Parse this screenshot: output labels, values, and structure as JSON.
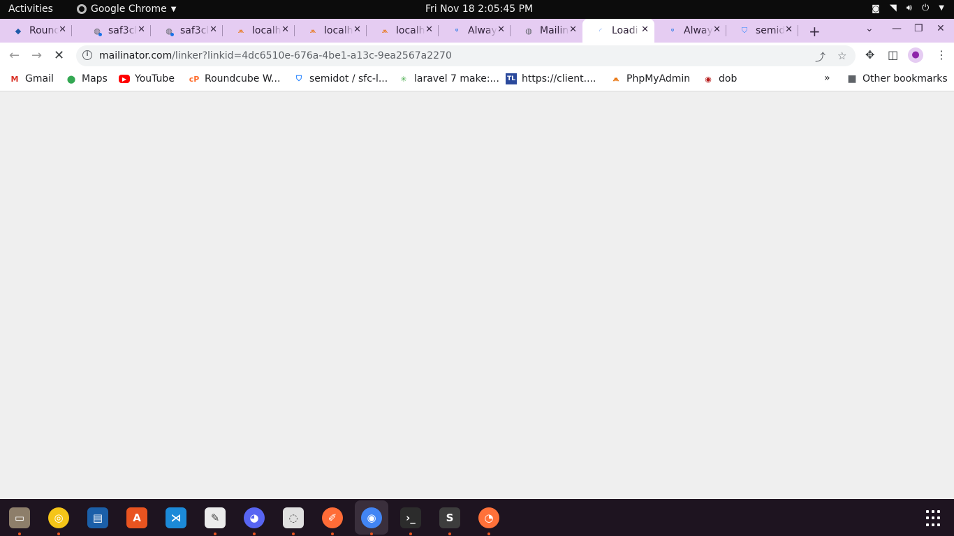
{
  "topbar": {
    "activities": "Activities",
    "app_name": "Google Chrome",
    "clock": "Fri Nov 18  2:05:45 PM"
  },
  "tabs": [
    {
      "title": "Roundcube",
      "icon": "roundcube-icon",
      "color": "#1e5aa8"
    },
    {
      "title": "saf3cl",
      "icon": "globe-icon",
      "color": "#5f6368"
    },
    {
      "title": "saf3cl",
      "icon": "globe-icon",
      "color": "#5f6368"
    },
    {
      "title": "localh",
      "icon": "phpmyadmin-icon",
      "color": "#e8730c"
    },
    {
      "title": "localh",
      "icon": "phpmyadmin-icon",
      "color": "#e8730c"
    },
    {
      "title": "localh",
      "icon": "phpmyadmin-icon",
      "color": "#e8730c"
    },
    {
      "title": "Alway",
      "icon": "ap-icon",
      "color": "#1a73e8"
    },
    {
      "title": "Mailin",
      "icon": "globe-icon",
      "color": "#5f6368"
    },
    {
      "title": "Loadi",
      "icon": "loading-spinner-icon",
      "color": "#8ab4f8"
    },
    {
      "title": "Alway",
      "icon": "ap-icon",
      "color": "#1a73e8"
    },
    {
      "title": "semid",
      "icon": "bitbucket-icon",
      "color": "#2684ff"
    }
  ],
  "toolbar": {
    "url_host": "mailinator.com",
    "url_path": "/linker?linkid=4dc6510e-676a-4be1-a13c-9ea2567a2270"
  },
  "bookmarks": [
    {
      "label": "Gmail",
      "icon": "gmail-icon",
      "color": "#d93025"
    },
    {
      "label": "Maps",
      "icon": "maps-pin-icon",
      "color": "#34a853"
    },
    {
      "label": "YouTube",
      "icon": "youtube-icon",
      "color": "#ff0000"
    },
    {
      "label": "Roundcube W...",
      "icon": "cpanel-icon",
      "color": "#ff6c2c"
    },
    {
      "label": "semidot / sfc-l...",
      "icon": "bitbucket-icon",
      "color": "#2684ff"
    },
    {
      "label": "laravel 7 make:...",
      "icon": "laravel-icon",
      "color": "#4caf50"
    },
    {
      "label": "https://client....",
      "icon": "tl-icon",
      "color": "#2b4a9c"
    },
    {
      "label": "PhpMyAdmin",
      "icon": "phpmyadmin-icon",
      "color": "#e8730c"
    },
    {
      "label": "dob",
      "icon": "dob-icon",
      "color": "#b71c1c"
    }
  ],
  "bookmarks_overflow": "»",
  "other_bookmarks": "Other bookmarks",
  "dock": [
    {
      "name": "files-app",
      "color": "#8d7e6a"
    },
    {
      "name": "rhythmbox-app",
      "color": "#f5c518"
    },
    {
      "name": "libreoffice-writer-app",
      "color": "#1b5fa8"
    },
    {
      "name": "software-center-app",
      "color": "#e95420"
    },
    {
      "name": "vscode-app",
      "color": "#1c8ad8"
    },
    {
      "name": "text-editor-app",
      "color": "#ececec"
    },
    {
      "name": "discord-app",
      "color": "#5865f2"
    },
    {
      "name": "screenshot-app",
      "color": "#e0e0e0"
    },
    {
      "name": "postman-app",
      "color": "#ff6c37"
    },
    {
      "name": "chrome-app",
      "color": "#4285f4"
    },
    {
      "name": "terminal-app",
      "color": "#2c2c2c"
    },
    {
      "name": "sublime-text-app",
      "color": "#3d3d3d"
    },
    {
      "name": "firefox-app",
      "color": "#ff7139"
    }
  ]
}
